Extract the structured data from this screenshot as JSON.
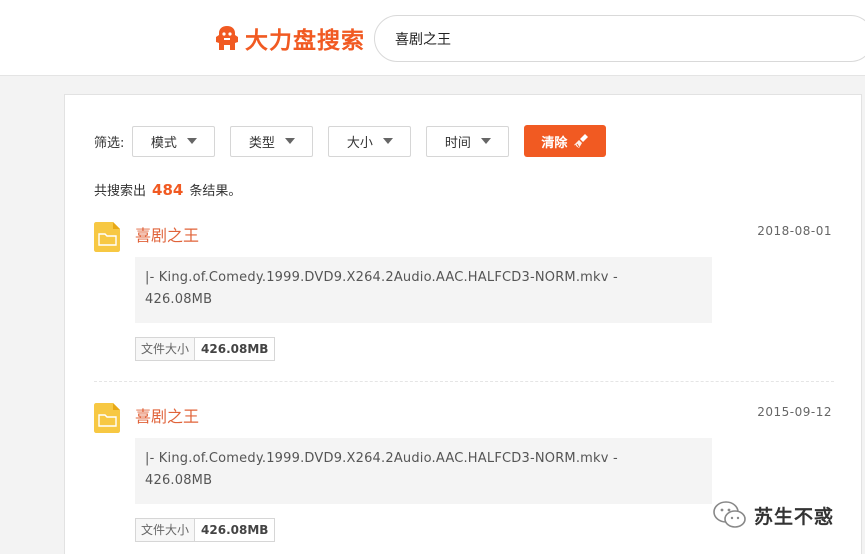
{
  "header": {
    "logo_text": "大力盘搜索",
    "search_value": "喜剧之王"
  },
  "filters": {
    "label": "筛选:",
    "buttons": [
      "模式",
      "类型",
      "大小",
      "时间"
    ],
    "clear_label": "清除"
  },
  "summary": {
    "prefix": "共搜索出",
    "count": "484",
    "suffix": "条结果。"
  },
  "results": [
    {
      "title": "喜剧之王",
      "date": "2018-08-01",
      "file_line": "|- King.of.Comedy.1999.DVD9.X264.2Audio.AAC.HALFCD3-NORM.mkv -",
      "file_size_inline": "426.08MB",
      "size_key": "文件大小",
      "size_value": "426.08MB"
    },
    {
      "title": "喜剧之王",
      "date": "2015-09-12",
      "file_line": "|- King.of.Comedy.1999.DVD9.X264.2Audio.AAC.HALFCD3-NORM.mkv -",
      "file_size_inline": "426.08MB",
      "size_key": "文件大小",
      "size_value": "426.08MB"
    }
  ],
  "watermark": {
    "text": "苏生不惑"
  },
  "colors": {
    "accent": "#f15a22",
    "title": "#e0633a",
    "folder": "#f7c843"
  }
}
